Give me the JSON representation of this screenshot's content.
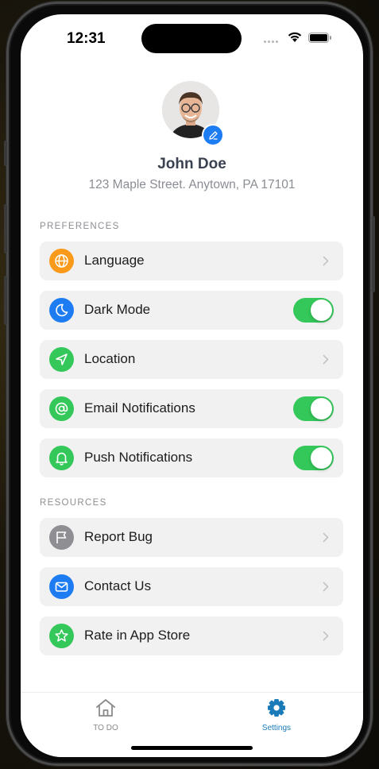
{
  "status_bar": {
    "time": "12:31"
  },
  "profile": {
    "name": "John Doe",
    "address": "123 Maple Street. Anytown, PA 17101"
  },
  "preferences": {
    "title": "PREFERENCES",
    "items": [
      {
        "label": "Language",
        "icon": "globe-icon",
        "icon_color": "#f99a1a",
        "control": "chevron"
      },
      {
        "label": "Dark Mode",
        "icon": "moon-icon",
        "icon_color": "#1e7cf2",
        "control": "toggle",
        "on": true
      },
      {
        "label": "Location",
        "icon": "location-arrow-icon",
        "icon_color": "#34c759",
        "control": "chevron"
      },
      {
        "label": "Email Notifications",
        "icon": "at-sign-icon",
        "icon_color": "#34c759",
        "control": "toggle",
        "on": true
      },
      {
        "label": "Push Notifications",
        "icon": "bell-icon",
        "icon_color": "#34c759",
        "control": "toggle",
        "on": true
      }
    ]
  },
  "resources": {
    "title": "RESOURCES",
    "items": [
      {
        "label": "Report Bug",
        "icon": "flag-icon",
        "icon_color": "#8e8e93",
        "control": "chevron"
      },
      {
        "label": "Contact Us",
        "icon": "mail-icon",
        "icon_color": "#1e7cf2",
        "control": "chevron"
      },
      {
        "label": "Rate in App Store",
        "icon": "star-icon",
        "icon_color": "#34c759",
        "control": "chevron"
      }
    ]
  },
  "tab_bar": {
    "tabs": [
      {
        "label": "TO DO",
        "icon": "home-icon",
        "active": false
      },
      {
        "label": "Settings",
        "icon": "gear-icon",
        "active": true
      }
    ]
  },
  "colors": {
    "accent_blue": "#1e7cf2",
    "toggle_green": "#34c759",
    "active_tab": "#1a7bb8",
    "inactive_tab": "#8a8a8a"
  }
}
